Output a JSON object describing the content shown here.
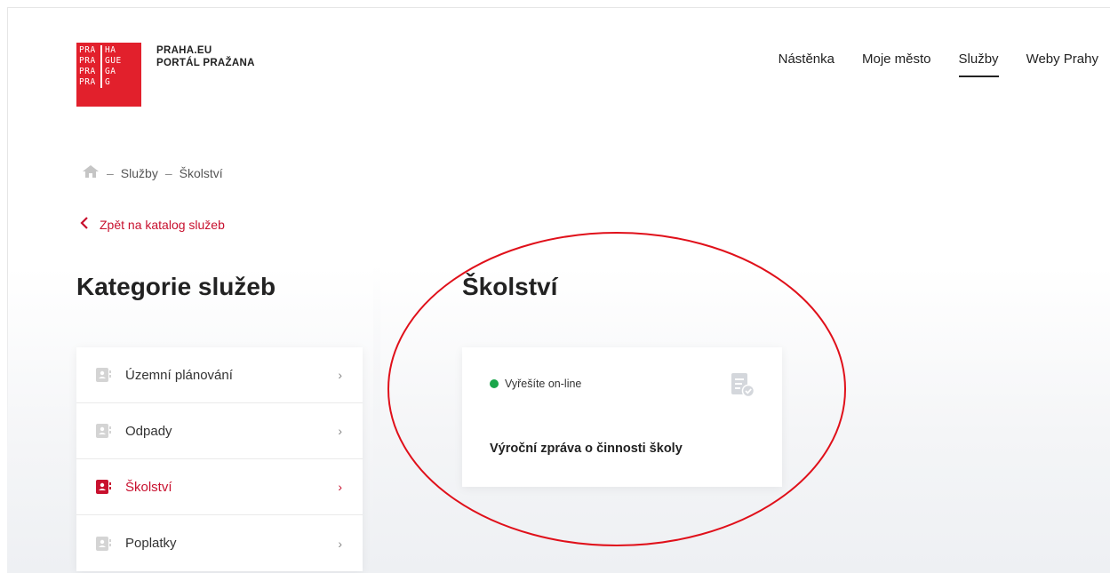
{
  "logo": {
    "rows": [
      [
        "PRA",
        "HA"
      ],
      [
        "PRA",
        "GUE"
      ],
      [
        "PRA",
        "GA"
      ],
      [
        "PRA",
        "G"
      ]
    ],
    "color": "#e2202c"
  },
  "brand": {
    "line1": "PRAHA.EU",
    "line2": "PORTÁL PRAŽANA"
  },
  "nav": {
    "items": [
      {
        "label": "Nástěnka"
      },
      {
        "label": "Moje město"
      },
      {
        "label": "Služby",
        "active": true
      },
      {
        "label": "Weby Prahy"
      }
    ]
  },
  "breadcrumb": {
    "home_icon": "home-icon",
    "separator": "–",
    "items": [
      "Služby",
      "Školství"
    ]
  },
  "back_link": {
    "label": "Zpět na katalog služeb",
    "icon": "chevron-left-icon"
  },
  "left_heading": "Kategorie služeb",
  "right_heading": "Školství",
  "categories": [
    {
      "label": "Územní plánování",
      "active": false
    },
    {
      "label": "Odpady",
      "active": false
    },
    {
      "label": "Školství",
      "active": true
    },
    {
      "label": "Poplatky",
      "active": false
    }
  ],
  "card": {
    "status": "Vyřešíte on-line",
    "status_color": "#1aa64a",
    "icon": "document-check-icon",
    "title": "Výroční zpráva o činnosti školy"
  },
  "accent_color": "#c8102e",
  "annotation": {
    "shape": "ellipse",
    "color": "#e0101a"
  }
}
